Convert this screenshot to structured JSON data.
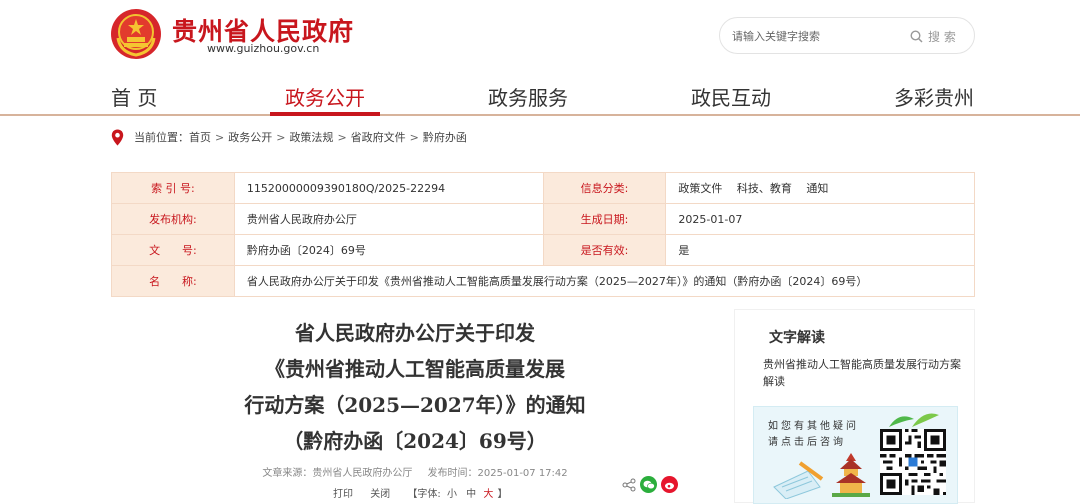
{
  "header": {
    "site_title": "贵州省人民政府",
    "site_url": "www.guizhou.gov.cn",
    "search_placeholder": "请输入关键字搜索",
    "search_button": "搜 索"
  },
  "nav": {
    "items": [
      {
        "label": "首 页",
        "active": false
      },
      {
        "label": "政务公开",
        "active": true
      },
      {
        "label": "政务服务",
        "active": false
      },
      {
        "label": "政民互动",
        "active": false
      },
      {
        "label": "多彩贵州",
        "active": false
      }
    ]
  },
  "breadcrumb": {
    "prefix": "当前位置：",
    "items": [
      "首页",
      "政务公开",
      "政策法规",
      "省政府文件",
      "黔府办函"
    ],
    "separator": ">"
  },
  "meta": {
    "index_label": "索 引 号:",
    "index_value": "11520000009390180Q/2025-22294",
    "category_label": "信息分类:",
    "category_value": "政策文件　 科技、教育　 通知",
    "publisher_label": "发布机构:",
    "publisher_value": "贵州省人民政府办公厅",
    "date_label": "生成日期:",
    "date_value": "2025-01-07",
    "docno_label": "文　　号:",
    "docno_value": "黔府办函〔2024〕69号",
    "valid_label": "是否有效:",
    "valid_value": "是",
    "name_label": "名　　称:",
    "name_value": "省人民政府办公厅关于印发《贵州省推动人工智能高质量发展行动方案（2025—2027年）》的通知（黔府办函〔2024〕69号）"
  },
  "article": {
    "title_line1": "省人民政府办公厅关于印发",
    "title_line2": "《贵州省推动人工智能高质量发展",
    "title_line3": "行动方案（2025—2027年）》的通知",
    "title_line4": "（黔府办函〔2024〕69号）",
    "source": "文章来源：贵州省人民政府办公厅",
    "publish_time": "发布时间：2025-01-07 17:42",
    "print": "打印",
    "close": "关闭",
    "font_label": "【字体:",
    "font_small": "小",
    "font_medium": "中",
    "font_large": "大",
    "font_end": "】"
  },
  "sidebar": {
    "title": "文字解读",
    "link": "贵州省推动人工智能高质量发展行动方案解读",
    "card_line1": "如您有其他疑问",
    "card_line2": "请点击后咨询"
  },
  "colors": {
    "brand_red": "#c8161d",
    "table_label_bg": "#fbeadc",
    "table_border": "#f3d9c6"
  }
}
